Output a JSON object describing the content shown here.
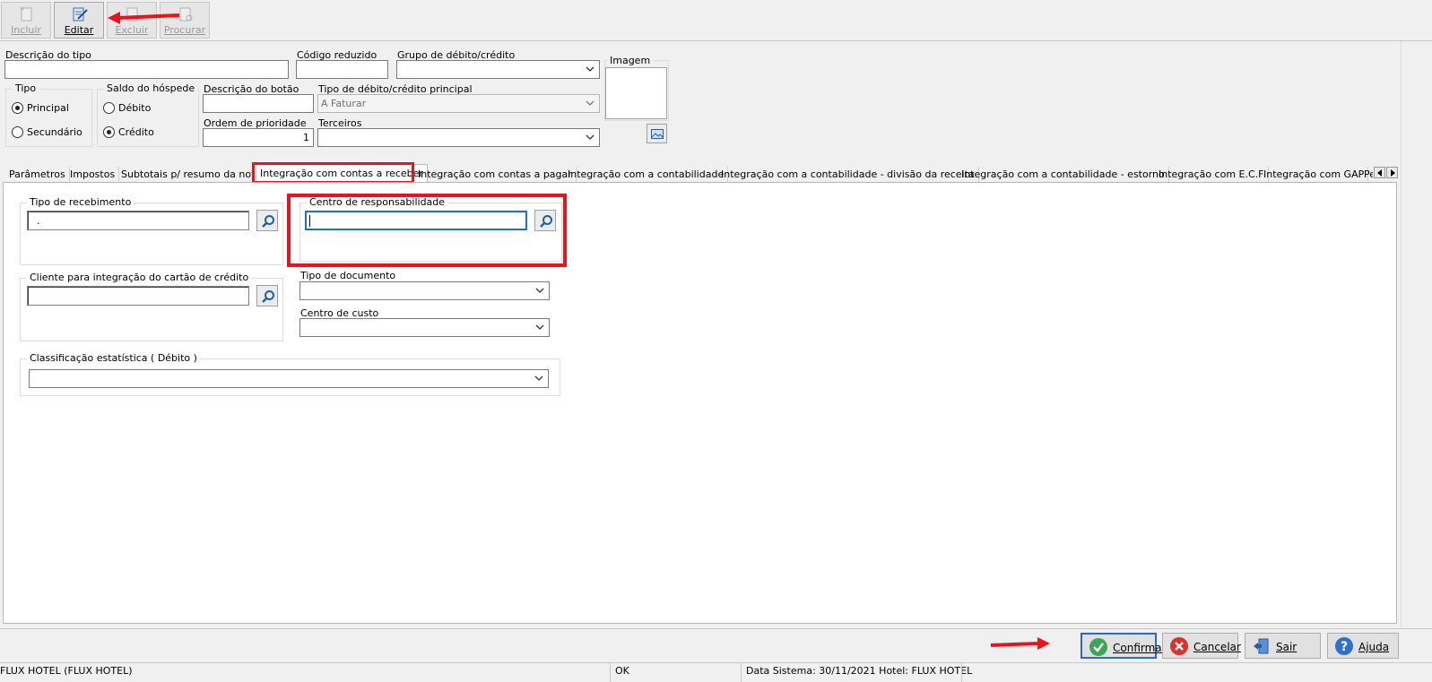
{
  "toolbar": {
    "incluir": "Incluir",
    "editar": "Editar",
    "excluir": "Excluir",
    "procurar": "Procurar"
  },
  "form": {
    "descricao_tipo_label": "Descrição do tipo",
    "descricao_tipo_value": "",
    "codigo_reduzido_label": "Código reduzido",
    "codigo_reduzido_value": "",
    "grupo_label": "Grupo de débito/crédito",
    "grupo_value": "",
    "imagem_label": "Imagem",
    "tipo_label": "Tipo",
    "tipo_principal": "Principal",
    "tipo_secundario": "Secundário",
    "saldo_label": "Saldo do hóspede",
    "saldo_debito": "Débito",
    "saldo_credito": "Crédito",
    "descricao_botao_label": "Descrição do botão",
    "descricao_botao_value": "",
    "tipo_principal_label": "Tipo de débito/crédito principal",
    "tipo_principal_value": "A Faturar",
    "ordem_label": "Ordem de prioridade",
    "ordem_value": "1",
    "terceiros_label": "Terceiros",
    "terceiros_value": ""
  },
  "tabs": [
    "Parâmetros",
    "Impostos",
    "Subtotais p/ resumo da nota",
    "Integração com contas a receber",
    "Integração com contas a pagar",
    "Integração com a contabilidade",
    "Integração com a contabilidade - divisão da receita",
    "Integração com a contabilidade - estorno",
    "Integração com E.C.F",
    "Integração com GAP",
    "Pe"
  ],
  "panel": {
    "tipo_recebimento_label": "Tipo de recebimento",
    "tipo_recebimento_value": ".",
    "centro_resp_label": "Centro de responsabilidade",
    "centro_resp_value": "",
    "cliente_label": "Cliente para integração do cartão de crédito",
    "cliente_value": "",
    "tipo_documento_label": "Tipo de documento",
    "tipo_documento_value": "",
    "centro_custo_label": "Centro de custo",
    "centro_custo_value": "",
    "classificacao_label": "Classificação estatística ( Débito )",
    "classificacao_value": ""
  },
  "footer": {
    "confirmar": "Confirmar",
    "cancelar": "Cancelar",
    "sair": "Sair",
    "ajuda": "Ajuda"
  },
  "status": {
    "left": "FLUX HOTEL (FLUX HOTEL)",
    "mid": "OK",
    "right": "Data Sistema: 30/11/2021  Hotel: FLUX HOTEL"
  },
  "colors": {
    "annotation_red": "#e8141b",
    "confirm_green": "#3aa657",
    "cancel_red": "#d9322f",
    "help_blue": "#2d72c8"
  }
}
